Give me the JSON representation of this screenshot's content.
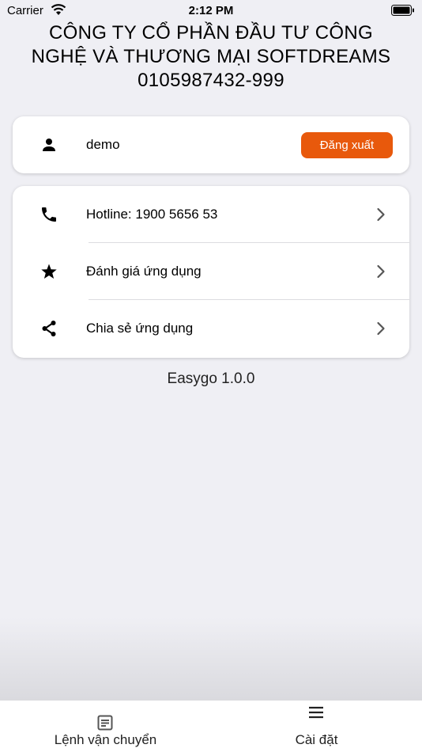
{
  "status_bar": {
    "carrier": "Carrier",
    "time": "2:12 PM"
  },
  "company": {
    "line1": "CÔNG TY CỔ PHẦN ĐẦU TƯ CÔNG",
    "line2": "NGHỆ VÀ THƯƠNG MẠI SOFTDREAMS",
    "line3": "0105987432-999"
  },
  "user": {
    "name": "demo",
    "logout_label": "Đăng xuất"
  },
  "menu": [
    {
      "label": "Hotline: 1900 5656 53",
      "icon": "phone-icon"
    },
    {
      "label": "Đánh giá ứng dụng",
      "icon": "star-icon"
    },
    {
      "label": "Chia sẻ ứng dụng",
      "icon": "share-icon"
    }
  ],
  "version": "Easygo 1.0.0",
  "tabs": [
    {
      "label": "Lệnh vận chuyển",
      "icon": "document-icon"
    },
    {
      "label": "Cài đặt",
      "icon": "menu-icon"
    }
  ],
  "colors": {
    "accent": "#e8590c",
    "background": "#efeff4"
  }
}
